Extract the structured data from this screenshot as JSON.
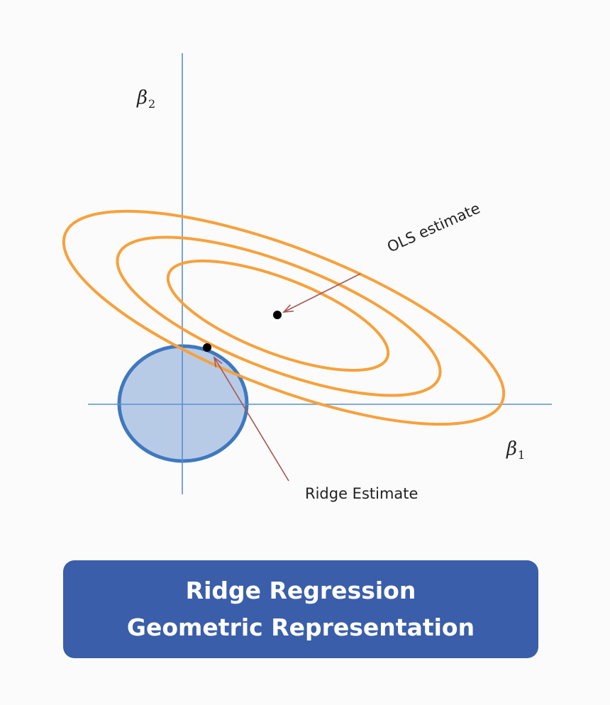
{
  "diagram": {
    "axes": {
      "x_label": "β",
      "x_label_sub": "1",
      "y_label": "β",
      "y_label_sub": "2"
    },
    "annotations": {
      "ols": "OLS estimate",
      "ridge": "Ridge Estimate"
    },
    "colors": {
      "axis": "#5b8fcf",
      "contour": "#f7a13c",
      "constraint_fill": "#b8cbe6",
      "constraint_stroke": "#3f78be",
      "arrow": "#a65656",
      "point": "#000000",
      "title_bg": "#3a5ea9",
      "title_text": "#ffffff"
    }
  },
  "title": {
    "line1": "Ridge Regression",
    "line2": "Geometric Representation"
  }
}
